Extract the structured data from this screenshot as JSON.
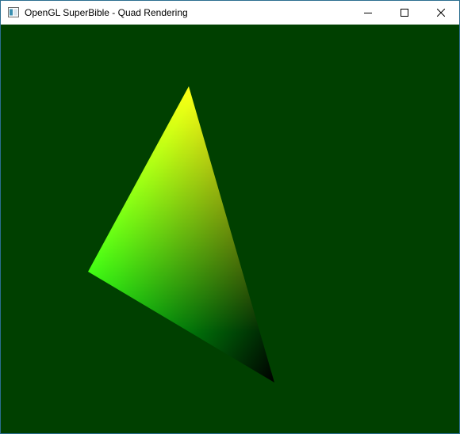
{
  "window": {
    "title": "OpenGL SuperBible - Quad Rendering",
    "icon": "app-window-icon"
  },
  "title_bar_controls": [
    {
      "name": "minimize-button",
      "icon": "minimize-icon"
    },
    {
      "name": "maximize-button",
      "icon": "maximize-icon"
    },
    {
      "name": "close-button",
      "icon": "close-icon"
    }
  ],
  "scene": {
    "clear_color": "#004000",
    "primitive": "triangle",
    "vertex_colors": {
      "top": "#ff1400",
      "left": "#00ff14",
      "bottom": "#000000"
    }
  },
  "colors": {
    "border": "#2b6e8f",
    "titlebar": "#ffffff"
  }
}
